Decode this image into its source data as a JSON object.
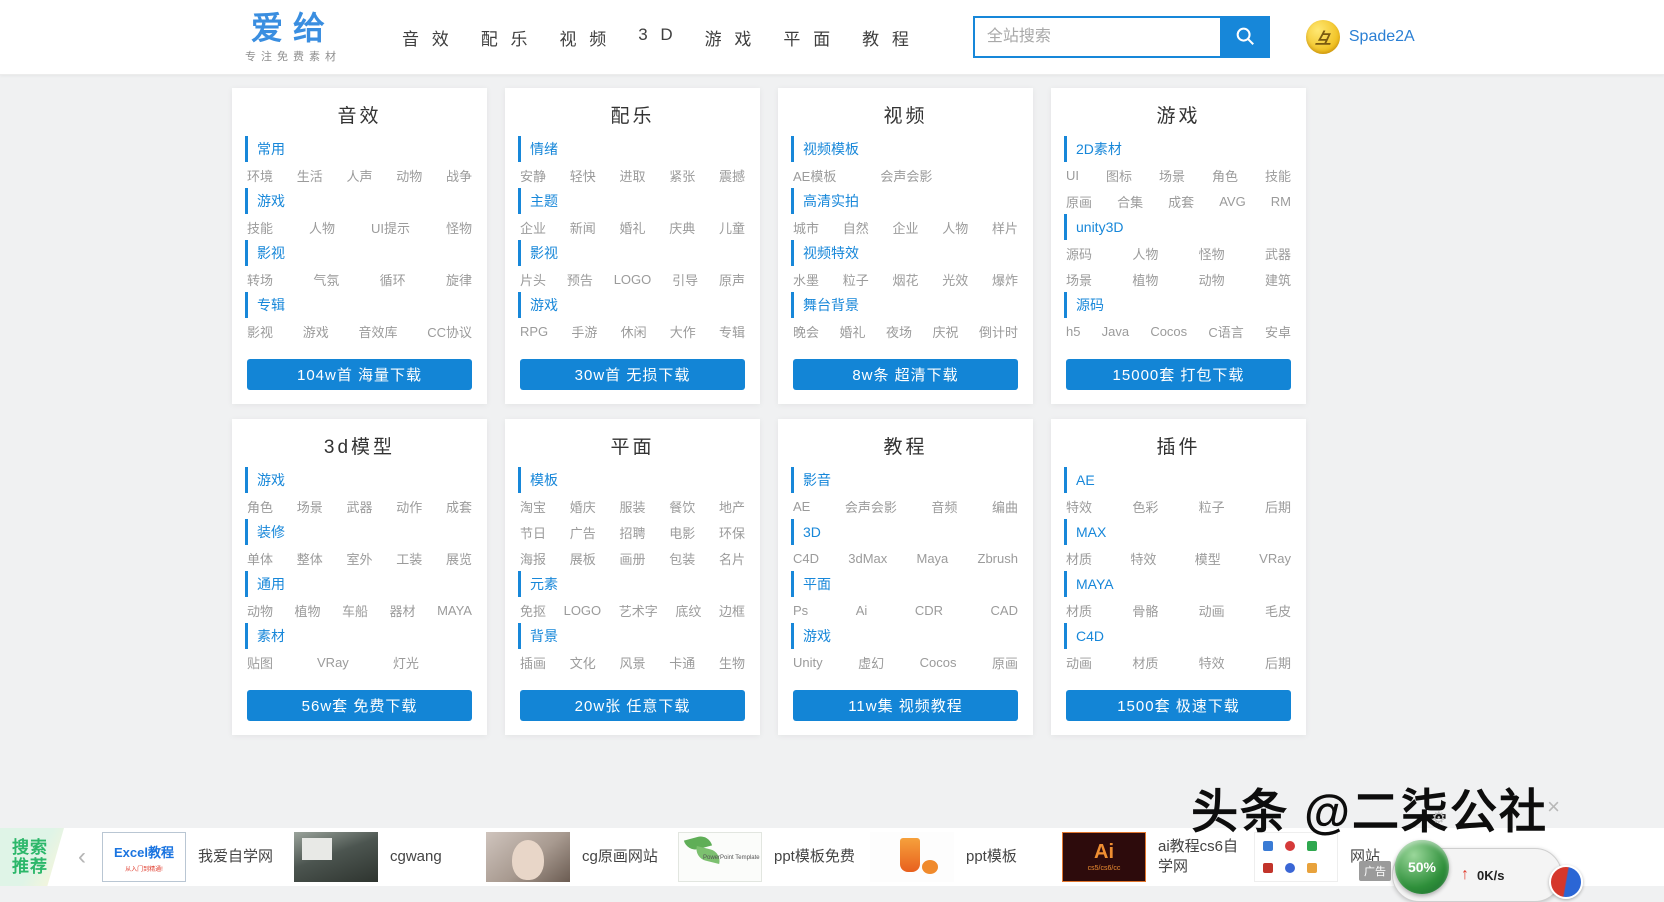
{
  "header": {
    "logo": {
      "title": "爱给",
      "subtitle": "专注免费素材"
    },
    "nav": [
      "音 效",
      "配 乐",
      "视 频",
      "3 D",
      "游 戏",
      "平 面",
      "教 程"
    ],
    "search": {
      "placeholder": "全站搜索",
      "icon": "search-icon"
    },
    "user": {
      "name": "Spade2A",
      "avatar_icon": "avatar"
    }
  },
  "colors": {
    "accent_blue": "#1787d9",
    "button_blue": "#1385d6",
    "link_gray": "#9b9b9b",
    "promo_green": "#2cb76a",
    "logo_blue": "#3a8ee0"
  },
  "cards": [
    {
      "title": "音效",
      "sections": [
        {
          "label": "常用",
          "rows": [
            [
              "环境",
              "生活",
              "人声",
              "动物",
              "战争"
            ]
          ]
        },
        {
          "label": "游戏",
          "rows": [
            [
              "技能",
              "人物",
              "UI提示",
              "怪物"
            ]
          ]
        },
        {
          "label": "影视",
          "rows": [
            [
              "转场",
              "气氛",
              "循环",
              "旋律"
            ]
          ]
        },
        {
          "label": "专辑",
          "rows": [
            [
              "影视",
              "游戏",
              "音效库",
              "CC协议"
            ]
          ]
        }
      ],
      "button": "104w首 海量下载"
    },
    {
      "title": "配乐",
      "sections": [
        {
          "label": "情绪",
          "rows": [
            [
              "安静",
              "轻快",
              "进取",
              "紧张",
              "震撼"
            ]
          ]
        },
        {
          "label": "主题",
          "rows": [
            [
              "企业",
              "新闻",
              "婚礼",
              "庆典",
              "儿童"
            ]
          ]
        },
        {
          "label": "影视",
          "rows": [
            [
              "片头",
              "预告",
              "LOGO",
              "引导",
              "原声"
            ]
          ]
        },
        {
          "label": "游戏",
          "rows": [
            [
              "RPG",
              "手游",
              "休闲",
              "大作",
              "专辑"
            ]
          ]
        }
      ],
      "button": "30w首 无损下载"
    },
    {
      "title": "视频",
      "sections": [
        {
          "label": "视频模板",
          "rows": [
            [
              "AE模板",
              "会声会影"
            ]
          ]
        },
        {
          "label": "高清实拍",
          "rows": [
            [
              "城市",
              "自然",
              "企业",
              "人物",
              "样片"
            ]
          ]
        },
        {
          "label": "视频特效",
          "rows": [
            [
              "水墨",
              "粒子",
              "烟花",
              "光效",
              "爆炸"
            ]
          ]
        },
        {
          "label": "舞台背景",
          "rows": [
            [
              "晚会",
              "婚礼",
              "夜场",
              "庆祝",
              "倒计时"
            ]
          ]
        }
      ],
      "button": "8w条 超清下载"
    },
    {
      "title": "游戏",
      "sections": [
        {
          "label": "2D素材",
          "rows": [
            [
              "UI",
              "图标",
              "场景",
              "角色",
              "技能"
            ],
            [
              "原画",
              "合集",
              "成套",
              "AVG",
              "RM"
            ]
          ]
        },
        {
          "label": "unity3D",
          "rows": [
            [
              "源码",
              "人物",
              "怪物",
              "武器"
            ],
            [
              "场景",
              "植物",
              "动物",
              "建筑"
            ]
          ]
        },
        {
          "label": "源码",
          "rows": [
            [
              "h5",
              "Java",
              "Cocos",
              "C语言",
              "安卓"
            ]
          ]
        }
      ],
      "button": "15000套 打包下载"
    },
    {
      "title": "3d模型",
      "sections": [
        {
          "label": "游戏",
          "rows": [
            [
              "角色",
              "场景",
              "武器",
              "动作",
              "成套"
            ]
          ]
        },
        {
          "label": "装修",
          "rows": [
            [
              "单体",
              "整体",
              "室外",
              "工装",
              "展览"
            ]
          ]
        },
        {
          "label": "通用",
          "rows": [
            [
              "动物",
              "植物",
              "车船",
              "器材",
              "MAYA"
            ]
          ]
        },
        {
          "label": "素材",
          "rows": [
            [
              "贴图",
              "VRay",
              "灯光"
            ]
          ]
        }
      ],
      "button": "56w套 免费下载"
    },
    {
      "title": "平面",
      "sections": [
        {
          "label": "模板",
          "rows": [
            [
              "淘宝",
              "婚庆",
              "服装",
              "餐饮",
              "地产"
            ],
            [
              "节日",
              "广告",
              "招聘",
              "电影",
              "环保"
            ],
            [
              "海报",
              "展板",
              "画册",
              "包装",
              "名片"
            ]
          ]
        },
        {
          "label": "元素",
          "rows": [
            [
              "免抠",
              "LOGO",
              "艺术字",
              "底纹",
              "边框"
            ]
          ]
        },
        {
          "label": "背景",
          "rows": [
            [
              "插画",
              "文化",
              "风景",
              "卡通",
              "生物"
            ]
          ]
        }
      ],
      "button": "20w张 任意下载"
    },
    {
      "title": "教程",
      "sections": [
        {
          "label": "影音",
          "rows": [
            [
              "AE",
              "会声会影",
              "音频",
              "编曲"
            ]
          ]
        },
        {
          "label": "3D",
          "rows": [
            [
              "C4D",
              "3dMax",
              "Maya",
              "Zbrush"
            ]
          ]
        },
        {
          "label": "平面",
          "rows": [
            [
              "Ps",
              "Ai",
              "CDR",
              "CAD"
            ]
          ]
        },
        {
          "label": "游戏",
          "rows": [
            [
              "Unity",
              "虚幻",
              "Cocos",
              "原画"
            ]
          ]
        }
      ],
      "button": "11w集 视频教程"
    },
    {
      "title": "插件",
      "sections": [
        {
          "label": "AE",
          "rows": [
            [
              "特效",
              "色彩",
              "粒子",
              "后期"
            ]
          ]
        },
        {
          "label": "MAX",
          "rows": [
            [
              "材质",
              "特效",
              "模型",
              "VRay"
            ]
          ]
        },
        {
          "label": "MAYA",
          "rows": [
            [
              "材质",
              "骨骼",
              "动画",
              "毛皮"
            ]
          ]
        },
        {
          "label": "C4D",
          "rows": [
            [
              "动画",
              "材质",
              "特效",
              "后期"
            ]
          ]
        }
      ],
      "button": "1500套 极速下载"
    }
  ],
  "footer": {
    "promo_line1": "搜索",
    "promo_line2": "推荐",
    "chevron": "‹",
    "items": [
      {
        "kind": "excel",
        "thumb_title": "Excel教程",
        "thumb_sub": "从入门到精通!",
        "label": "我爱自学网"
      },
      {
        "kind": "classroom",
        "label": "cgwang"
      },
      {
        "kind": "portrait",
        "label": "cg原画网站"
      },
      {
        "kind": "ppt",
        "thumb_title": "PowerPoint Template",
        "label": "ppt模板免费"
      },
      {
        "kind": "drink",
        "label": "ppt模板"
      },
      {
        "kind": "ai",
        "thumb_title": "Ai",
        "thumb_sub": "cs5/cs6/cc",
        "label": "ai教程cs6自学网"
      },
      {
        "kind": "logos",
        "label": "网站"
      }
    ],
    "close_icon": "×",
    "gear_icon": "⚙"
  },
  "overlay": {
    "watermark": "头条 @二柒公社",
    "widget": {
      "ad_label": "广告",
      "percent": "50%",
      "arrow": "↑",
      "speed": "0K/s"
    }
  }
}
